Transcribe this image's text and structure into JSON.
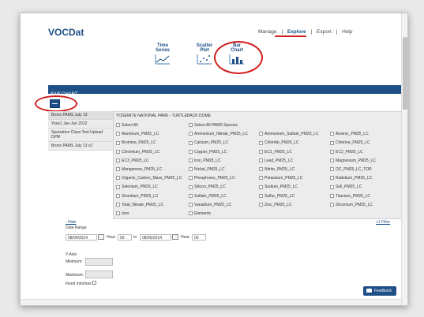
{
  "brand": "VOCDat",
  "nav": {
    "manage": "Manage",
    "explore": "Explore",
    "export": "Export",
    "help": "Help",
    "sep": "|"
  },
  "viz": {
    "time_series": [
      "Time",
      "Series"
    ],
    "scatter_plot": [
      "Scatter",
      "Plot"
    ],
    "bar_chart": [
      "Bar",
      "Chart"
    ]
  },
  "section_title": "BAR CHART",
  "datasets": [
    "Bronx PAMS July 13",
    "Yose1 Jan-Jun 2012",
    "Speciation Class Test Upload DPM",
    "Bronx PAMS July 13 v2"
  ],
  "site_title": "YOSEMITE NATIONAL PARK - TURTLEBACK DOME",
  "select_all": "Select All",
  "select_all_pams": "Select All PAMS Species",
  "species": [
    [
      "Aluminum_PM25_LC",
      "Ammonium_Nitrate_PM25_LC",
      "Ammonium_Sulfate_PM25_LC",
      "Arsenic_PM25_LC"
    ],
    [
      "Bromine_PM25_LC",
      "Calcium_PM25_LC",
      "Chloride_PM25_LC",
      "Chlorine_PM25_LC"
    ],
    [
      "Chromium_PM25_LC",
      "Copper_PM25_LC",
      "EC1_PM25_LC",
      "EC2_PM25_LC"
    ],
    [
      "EC3_PM25_LC",
      "Iron_PM25_LC",
      "Lead_PM25_LC",
      "Magnesium_PM25_LC"
    ],
    [
      "Manganese_PM25_LC",
      "Nickel_PM25_LC",
      "Nitrite_PM25_LC",
      "OC_PM25_LC_TOR"
    ],
    [
      "Organic_Carbon_Mass_PM25_LC",
      "Phosphorus_PM25_LC",
      "Potassium_PM25_LC",
      "Rubidium_PM25_LC"
    ],
    [
      "Selenium_PM25_LC",
      "Silicon_PM25_LC",
      "Sodium_PM25_LC",
      "Soil_PM25_LC"
    ],
    [
      "Strontium_PM25_LC",
      "Sulfate_PM25_LC",
      "Sulfur_PM25_LC",
      "Titanium_PM25_LC"
    ],
    [
      "Total_Nitrate_PM25_LC",
      "Vanadium_PM25_LC",
      "Zinc_PM25_LC",
      "Zirconium_PM25_LC"
    ]
  ],
  "extra_options": [
    "Ions",
    "Elements"
  ],
  "link_left": "- Hide",
  "link_right": "+1 Filter",
  "date_range": {
    "label": "Date Range",
    "from": "08/04/2014",
    "hour_label": "Hour:",
    "hour_from": "00",
    "to_label": "to",
    "to": "08/05/2014",
    "hour_to": "00"
  },
  "y_axis": {
    "label": "Y-Axis",
    "minimum": "Minimum:",
    "maximum": "Maximum:",
    "fixed": "Fixed min/max:"
  },
  "feedback": "Feedback",
  "colors": {
    "brand_blue": "#1e4f86",
    "annotation_red": "#d21d1d"
  }
}
